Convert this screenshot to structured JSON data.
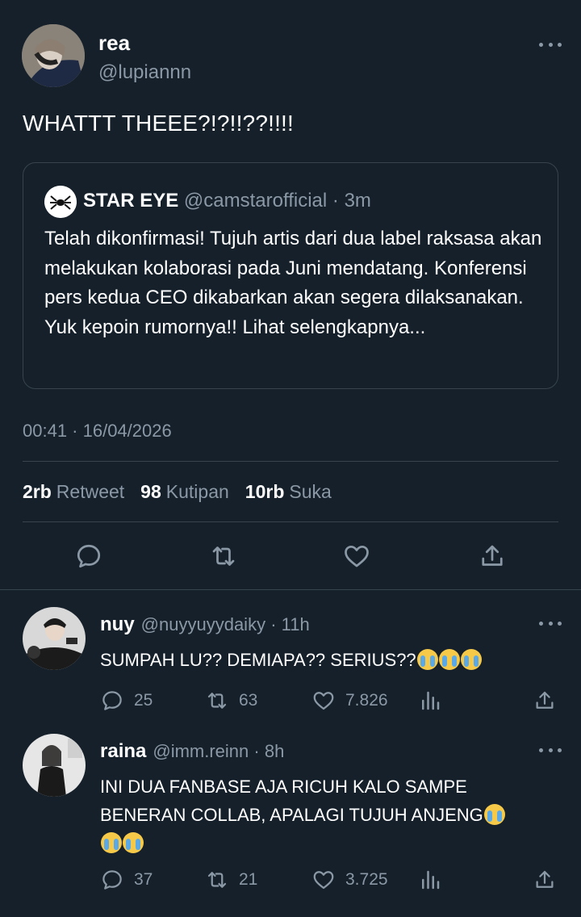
{
  "tweet": {
    "author_name": "rea",
    "author_handle": "@lupiannn",
    "text": "WHATTT THEEE?!?!!??!!!!",
    "quote": {
      "name": "STAR EYE",
      "handle": "@camstarofficial",
      "time": "· 3m",
      "text": "Telah dikonfirmasi! Tujuh artis dari dua label raksasa akan melakukan kolaborasi pada Juni mendatang. Konferensi pers kedua CEO dikabarkan akan segera dilaksanakan. Yuk kepoin rumornya!! Lihat selengkapnya..."
    },
    "timestamp": "00:41 · 16/04/2026",
    "stats": {
      "retweets_count": "2rb",
      "retweets_label": "Retweet",
      "quotes_count": "98",
      "quotes_label": "Kutipan",
      "likes_count": "10rb",
      "likes_label": "Suka"
    },
    "actions": [
      "reply-icon",
      "retweet-icon",
      "like-icon",
      "share-icon"
    ]
  },
  "replies": [
    {
      "name": "nuy",
      "handle": "@nuyyuyydaiky",
      "time": "· 11h",
      "text": "SUMPAH LU?? DEMIAPA?? SERIUS??",
      "reply_count": "25",
      "retweet_count": "63",
      "like_count": "7.826"
    },
    {
      "name": "raina",
      "handle": "@imm.reinn",
      "time": "· 8h",
      "text_line1": "INI DUA FANBASE AJA RICUH KALO SAMPE",
      "text_line2": "BENERAN COLLAB, APALAGI TUJUH ANJENG",
      "reply_count": "37",
      "retweet_count": "21",
      "like_count": "3.725"
    }
  ],
  "colors": {
    "background": "#15202b",
    "muted_text": "#8b98a5",
    "border": "#38444d"
  }
}
